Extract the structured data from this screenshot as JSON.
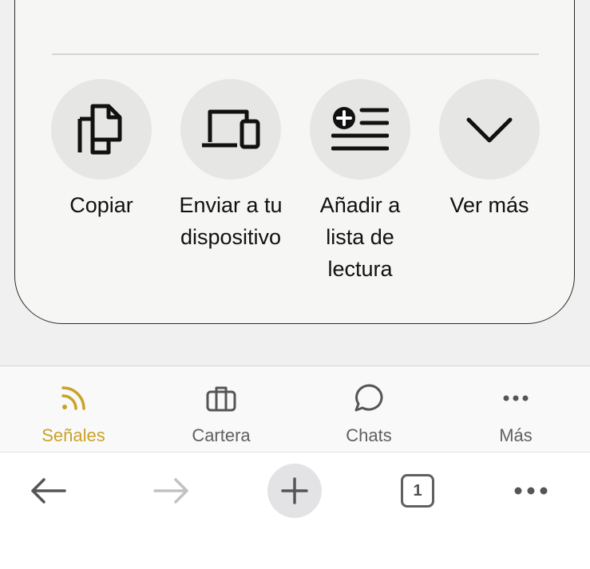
{
  "share_actions": [
    {
      "label": "Copiar",
      "icon": "copy-icon"
    },
    {
      "label": "Enviar a tu\ndispositivo",
      "icon": "devices-icon"
    },
    {
      "label": "Añadir a\nlista de\nlectura",
      "icon": "add-to-reading-list-icon"
    },
    {
      "label": "Ver más",
      "icon": "chevron-down-icon"
    }
  ],
  "tabbar": {
    "active_color": "#c9a227",
    "items": [
      {
        "label": "Señales",
        "icon": "feed-icon",
        "active": true
      },
      {
        "label": "Cartera",
        "icon": "briefcase-icon",
        "active": false
      },
      {
        "label": "Chats",
        "icon": "chat-bubble-icon",
        "active": false
      },
      {
        "label": "Más",
        "icon": "more-dots-icon",
        "active": false
      }
    ]
  },
  "browser_toolbar": {
    "open_tabs_count": "1",
    "buttons": [
      "back-arrow-icon",
      "forward-arrow-icon",
      "plus-icon",
      "tab-count",
      "more-dots-icon"
    ]
  }
}
